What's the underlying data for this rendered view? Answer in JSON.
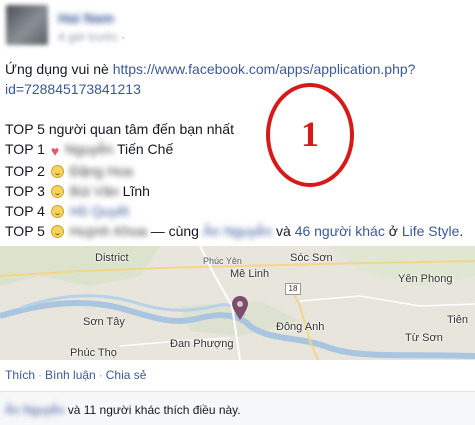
{
  "post": {
    "author": "Hai Nam",
    "timestamp": "4 giờ trước",
    "timestamp_suffix": "·",
    "intro": "Ứng dụng vui nè",
    "link_line1": "https://www.facebook.com/apps/application.php?",
    "link_line2": "id=728845173841213",
    "list_title": "TOP 5 người quan tâm đến bạn nhất",
    "top": [
      {
        "label": "TOP 1",
        "emoji": "heart-icon",
        "name": "Nguyễn",
        "suffix": "Tiến Chế"
      },
      {
        "label": "TOP 2",
        "emoji": "smile-icon",
        "name": "Đặng Hoa",
        "suffix": ""
      },
      {
        "label": "TOP 3",
        "emoji": "smile-icon",
        "name": "Bùi Văn",
        "suffix": "Lĩnh"
      },
      {
        "label": "TOP 4",
        "emoji": "smile-icon",
        "name": "Hồ Quyết",
        "suffix": ""
      },
      {
        "label": "TOP 5",
        "emoji": "smile-icon",
        "name": "Huỳnh Khoa",
        "suffix": ""
      }
    ],
    "with_text": "— cùng",
    "with_name": "Ân Nguyễn",
    "and_text": "và",
    "others_link": "46 người khác",
    "at_text": "ở",
    "place": "Life Style",
    "place_end": "."
  },
  "annotation": {
    "number": "1",
    "color": "#d61a1a"
  },
  "map": {
    "labels": [
      {
        "text": "District"
      },
      {
        "text": "Phúc Yên"
      },
      {
        "text": "Sóc Sơn"
      },
      {
        "text": "Mê Linh"
      },
      {
        "text": "Yên Phong"
      },
      {
        "text": "Sơn Tây"
      },
      {
        "text": "Đông Anh"
      },
      {
        "text": "Tiên"
      },
      {
        "text": "Phúc Thọ"
      },
      {
        "text": "Đan Phượng"
      },
      {
        "text": "Từ Sơn"
      }
    ],
    "road_number": "18"
  },
  "actions": {
    "like": "Thích",
    "comment": "Bình luận",
    "share": "Chia sẻ",
    "sep": "·"
  },
  "likes": {
    "name": "Ân Nguyễn",
    "text": "và 11 người khác thích điều này."
  },
  "colors": {
    "link": "#3b5998",
    "text": "#141823",
    "muted": "#9197a3"
  }
}
